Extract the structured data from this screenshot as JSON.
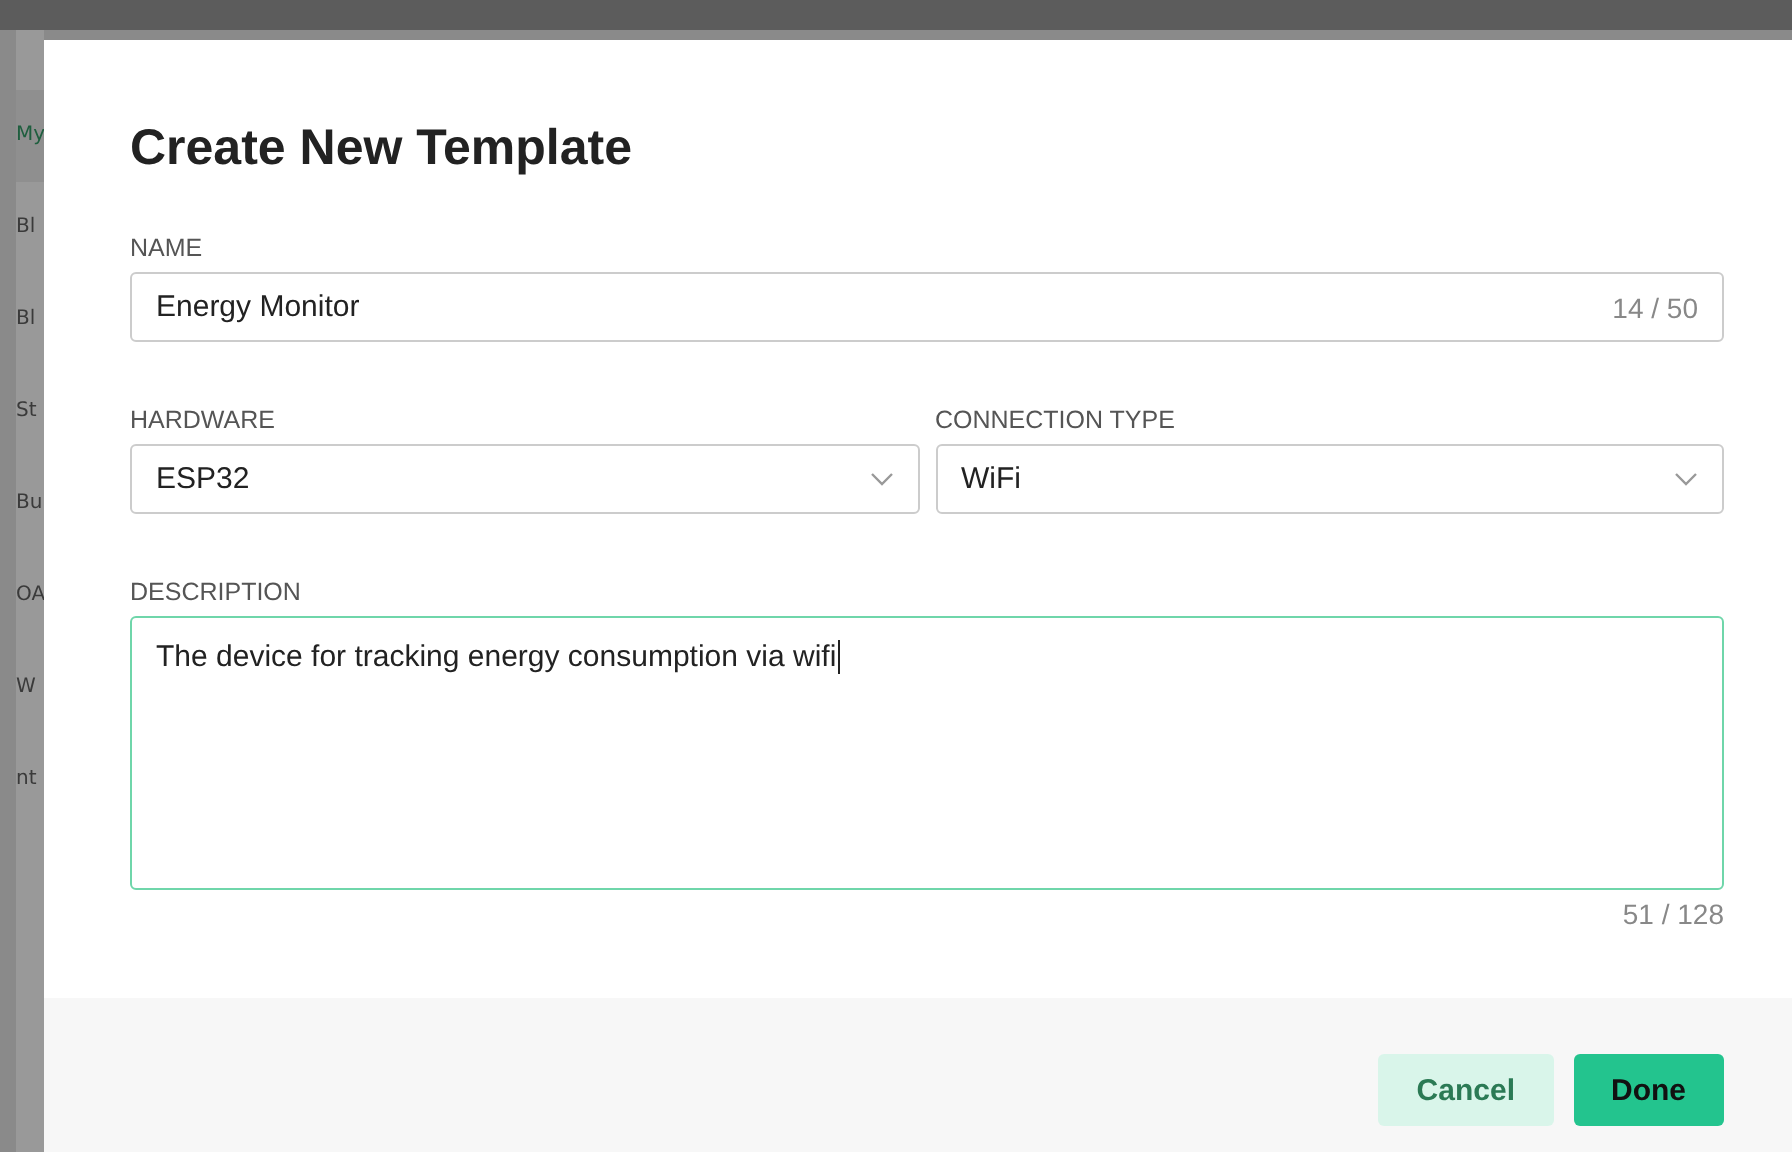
{
  "sidebar": {
    "items": [
      {
        "label": "My",
        "selected": true
      },
      {
        "label": "Bl",
        "selected": false
      },
      {
        "label": "Bl",
        "selected": false
      },
      {
        "label": "St",
        "selected": false
      },
      {
        "label": "Bu",
        "selected": false
      },
      {
        "label": "OA",
        "selected": false
      },
      {
        "label": "W",
        "selected": false
      },
      {
        "label": "nt",
        "selected": false
      }
    ]
  },
  "dialog": {
    "title": "Create New Template",
    "name": {
      "label": "NAME",
      "value": "Energy Monitor",
      "counter": "14 / 50"
    },
    "hardware": {
      "label": "HARDWARE",
      "value": "ESP32"
    },
    "connection_type": {
      "label": "CONNECTION TYPE",
      "value": "WiFi"
    },
    "description": {
      "label": "DESCRIPTION",
      "value": "The device for tracking energy consumption via wifi",
      "counter": "51 / 128",
      "focused": true
    },
    "buttons": [
      {
        "label": "Cancel",
        "kind": "secondary"
      },
      {
        "label": "Done",
        "kind": "primary"
      }
    ]
  }
}
